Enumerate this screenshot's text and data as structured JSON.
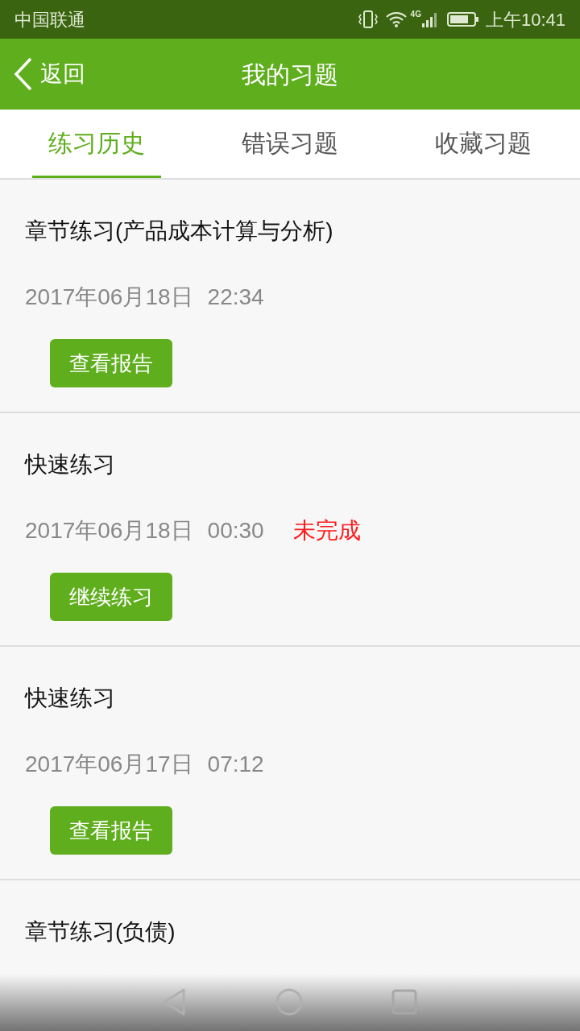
{
  "status_bar": {
    "carrier": "中国联通",
    "network": "4G",
    "time": "上午10:41"
  },
  "header": {
    "back": "返回",
    "title": "我的习题"
  },
  "tabs": [
    {
      "label": "练习历史",
      "selected": true
    },
    {
      "label": "错误习题",
      "selected": false
    },
    {
      "label": "收藏习题",
      "selected": false
    }
  ],
  "records": [
    {
      "title": "章节练习(产品成本计算与分析)",
      "date": "2017年06月18日",
      "time": "22:34",
      "button": "查看报告"
    },
    {
      "title": "快速练习",
      "date": "2017年06月18日",
      "time": "00:30",
      "status": "未完成",
      "button": "继续练习"
    },
    {
      "title": "快速练习",
      "date": "2017年06月17日",
      "time": "07:12",
      "button": "查看报告"
    },
    {
      "title": "章节练习(负债)"
    }
  ]
}
